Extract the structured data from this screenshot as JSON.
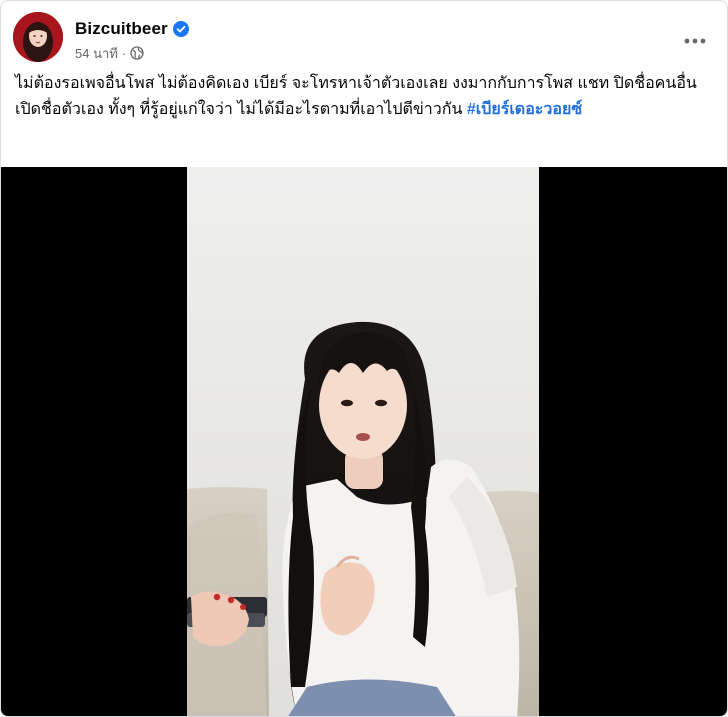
{
  "post": {
    "page_name": "Bizcuitbeer",
    "time_ago": "54 นาที",
    "separator": "·",
    "audience_icon": "globe-icon",
    "verified_icon": "verified-badge-icon",
    "more_icon": "more-options-icon",
    "caption_text": "ไม่ต้องรอเพจอื่นโพส ไม่ต้องคิดเอง เบียร์ จะโทรหาเจ้าตัวเองเลย งงมากกับการโพส แชท ปิดชื่อคนอื่น เปิดชื่อตัวเอง ทั้งๆ ที่รู้อยู่แก่ใจว่า ไม่ได้มีอะไรตามที่เอาไปตีข่าวกัน ",
    "hashtag": "#เบียร์เดอะวอยซ์",
    "colors": {
      "text": "#050505",
      "secondary": "#65676b",
      "hashtag": "#216fdb",
      "verified": "#1877f2",
      "video_bg": "#000000"
    }
  }
}
